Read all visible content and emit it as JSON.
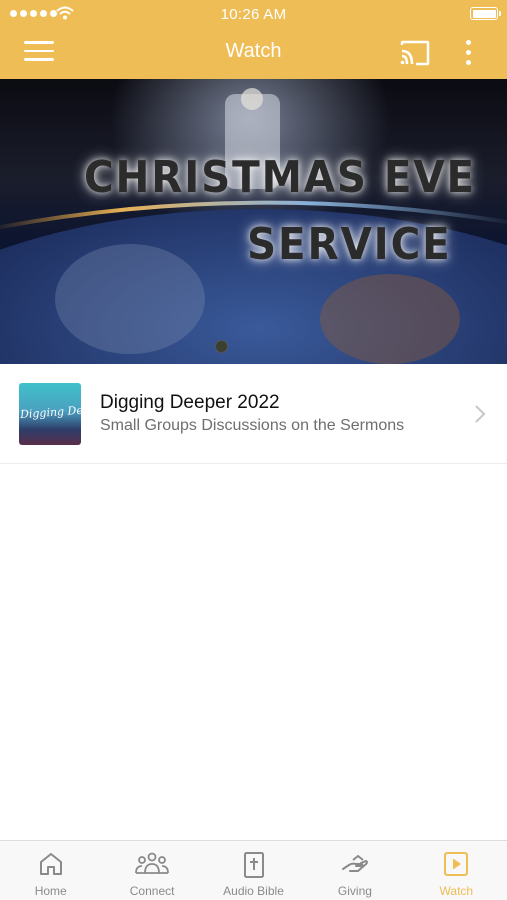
{
  "status_bar": {
    "time": "10:26 AM"
  },
  "navbar": {
    "title": "Watch",
    "menu_icon": "hamburger-menu-icon",
    "cast_icon": "cast-icon",
    "more_icon": "more-vertical-icon"
  },
  "hero": {
    "line1": "CHRISTMAS EVE",
    "line2": "SERVICE"
  },
  "list": {
    "items": [
      {
        "title": "Digging Deeper 2022",
        "subtitle": "Small Groups Discussions on the Sermons",
        "thumbnail_text": "Digging Deeper",
        "icon": "chevron-right-icon"
      }
    ]
  },
  "tabbar": {
    "active": "Watch",
    "accent_color": "#efbd55",
    "tabs": [
      {
        "label": "Home",
        "icon": "home-icon"
      },
      {
        "label": "Connect",
        "icon": "people-icon"
      },
      {
        "label": "Audio Bible",
        "icon": "bible-icon"
      },
      {
        "label": "Giving",
        "icon": "giving-hand-icon"
      },
      {
        "label": "Watch",
        "icon": "play-square-icon"
      }
    ]
  }
}
